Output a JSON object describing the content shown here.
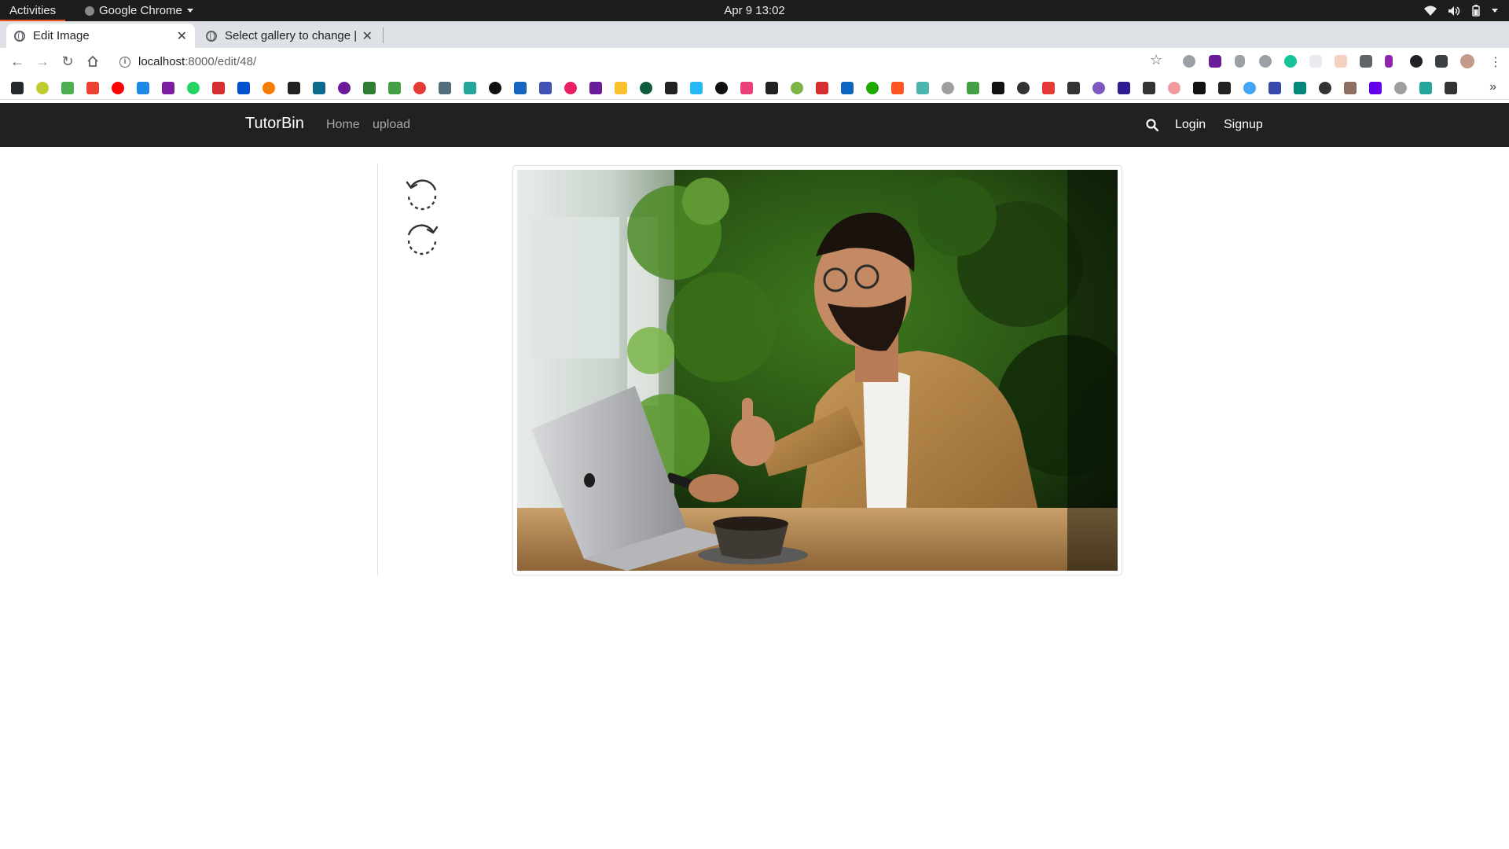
{
  "system": {
    "activities": "Activities",
    "app_name": "Google Chrome",
    "clock": "Apr 9  13:02"
  },
  "browser": {
    "tabs": [
      {
        "title": "Edit Image",
        "active": true
      },
      {
        "title": "Select gallery to change | ",
        "active": false
      }
    ],
    "url_host": "localhost",
    "url_path": ":8000/edit/48/"
  },
  "navbar": {
    "brand": "TutorBin",
    "links": [
      "Home",
      "upload"
    ],
    "login": "Login",
    "signup": "Signup"
  },
  "editor": {
    "tools": [
      {
        "name": "rotate-left-icon"
      },
      {
        "name": "rotate-right-icon"
      }
    ],
    "image": "man with laptop and coffee giving thumbs up"
  },
  "colors": {
    "navbar_bg": "#212121",
    "accent_orange": "#e95420"
  }
}
